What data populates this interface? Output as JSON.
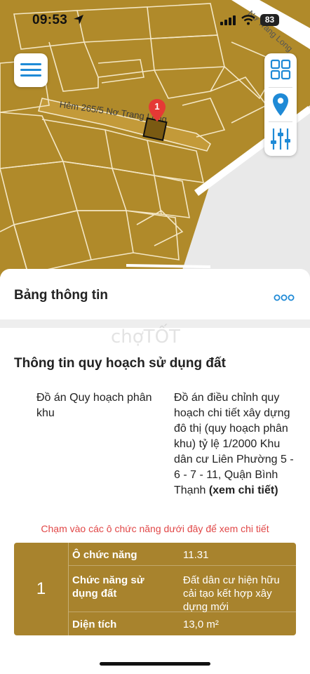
{
  "status": {
    "time": "09:53",
    "battery": "83"
  },
  "map": {
    "street_label": "Hẻm 265/5 Nơ Trang Long",
    "road_label": "Nơ Trang Long",
    "pin_number": "1",
    "colors": {
      "land": "#b08a2a",
      "road": "#ffffff",
      "accent": "#1f8ad6",
      "pin": "#e53935"
    }
  },
  "toolbar": {
    "items": [
      "layers-icon",
      "location-pin-icon",
      "sliders-icon"
    ]
  },
  "sheet": {
    "title": "Bảng thông tin",
    "watermark": "chợTỐT",
    "section_title": "Thông tin quy hoạch sử dụng đất",
    "plan_label": "Đồ án Quy hoạch phân khu",
    "plan_value": "Đồ án điều chỉnh quy hoạch chi tiết xây dựng đô thị (quy hoạch phân khu) tỷ lệ 1/2000 Khu dân cư Liên Phường 5 - 6 - 7 - 11, Quận Bình Thạnh",
    "plan_link": "(xem chi tiết)",
    "hint": "Chạm vào các ô chức năng dưới đây để xem chi tiết",
    "table": {
      "index": "1",
      "rows": [
        {
          "key": "Ô chức năng",
          "value": "11.31"
        },
        {
          "key": "Chức năng sử dụng đất",
          "value": "Đất dân cư hiện hữu cải tạo kết hợp xây dựng mới"
        },
        {
          "key": "Diện tích",
          "value": "13,0 m²"
        }
      ]
    }
  }
}
